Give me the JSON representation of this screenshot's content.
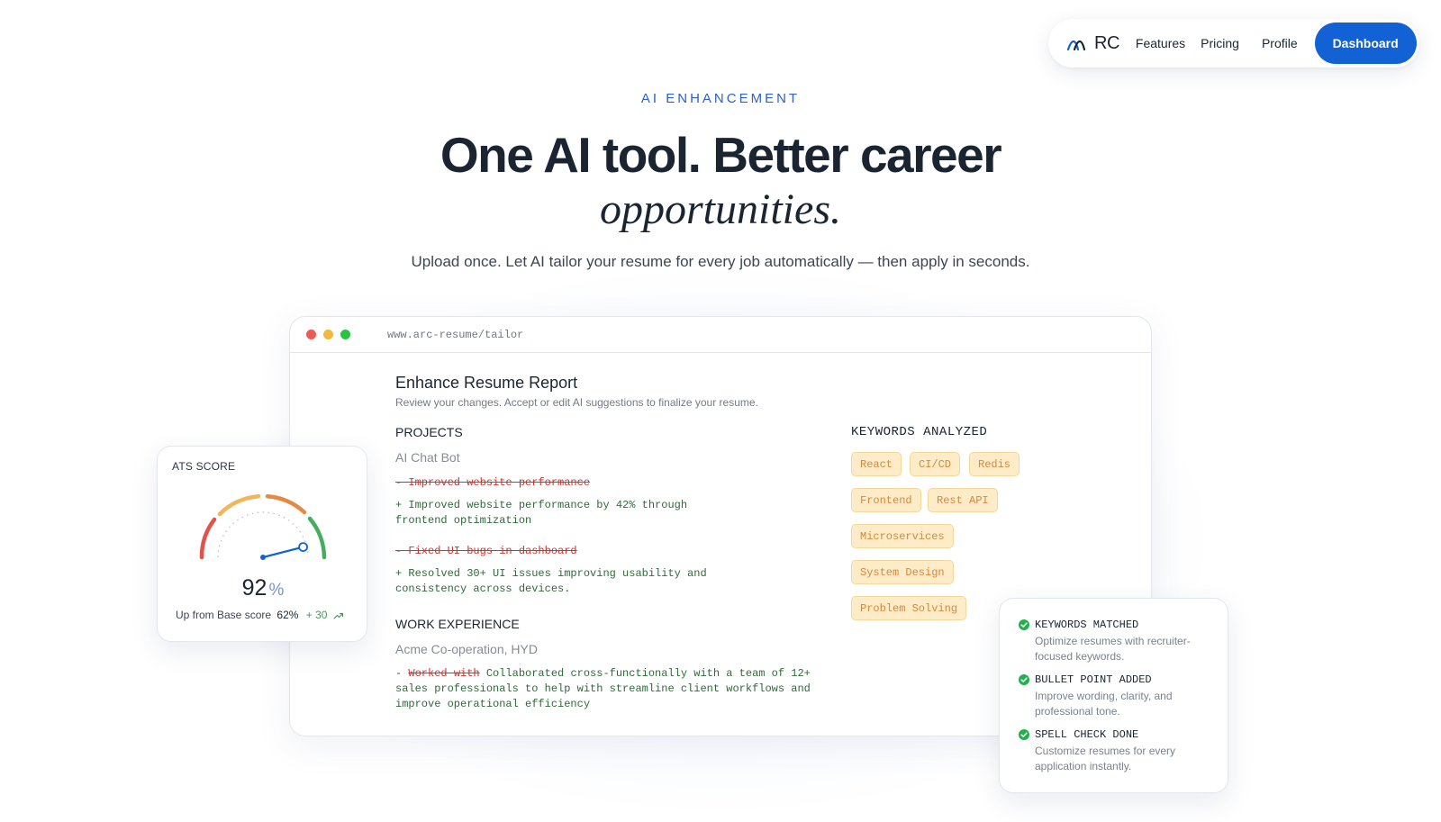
{
  "nav": {
    "logo_text": "RC",
    "links": [
      "Features",
      "Pricing",
      "Profile"
    ],
    "cta": "Dashboard",
    "accent_color": "#1262d6"
  },
  "hero": {
    "eyebrow": "AI ENHANCEMENT",
    "headline": "One AI tool. Better career",
    "headline_italic": "opportunities.",
    "subline": "Upload once. Let AI tailor your resume for every job automatically — then apply in seconds."
  },
  "browser": {
    "url": "www.arc-resume/tailor",
    "report_title": "Enhance Resume Report",
    "report_subtitle": "Review your changes. Accept or edit AI suggestions to finalize your resume.",
    "projects": {
      "heading": "PROJECTS",
      "name": "AI Chat Bot",
      "changes": [
        {
          "removed": "- Improved website performance",
          "added_1": "+ Improved website performance by 42% through",
          "added_2": "frontend optimization"
        },
        {
          "removed": "- Fixed UI bugs in dashboard",
          "added_1": "+ Resolved 30+ UI issues improving usability and",
          "added_2": "consistency across devices."
        }
      ]
    },
    "work": {
      "heading": "WORK EXPERIENCE",
      "company": "Acme Co-operation, HYD",
      "prefix": "- ",
      "removed": "Worked with",
      "line_1": " Collaborated cross-functionally with a team of 12+",
      "line_2": "sales professionals to help with streamline client workflows and",
      "line_3": "improve operational efficiency"
    },
    "keywords": {
      "heading": "KEYWORDS ANALYZED",
      "items": [
        "React",
        "CI/CD",
        "Redis",
        "Frontend",
        "Rest API",
        "Microservices",
        "System Design",
        "Problem Solving"
      ]
    }
  },
  "ats": {
    "label": "ATS SCORE",
    "score": "92",
    "score_fraction": 0.92,
    "unit": "%",
    "base_label": "Up from Base score",
    "base_value": "62%",
    "gain": "+ 30",
    "trend_icon": "trend-up-icon"
  },
  "checklist": [
    {
      "title": "KEYWORDS MATCHED",
      "desc": "Optimize resumes with recruiter-focused keywords."
    },
    {
      "title": "BULLET POINT ADDED",
      "desc": "Improve wording, clarity, and professional tone."
    },
    {
      "title": "SPELL CHECK DONE",
      "desc": "Customize resumes for every application instantly."
    }
  ],
  "colors": {
    "removed": "#c6352f",
    "added": "#2e6a3a",
    "chip_bg": "#fdecc7",
    "chip_text": "#d5893a",
    "check_green": "#21b04b"
  }
}
